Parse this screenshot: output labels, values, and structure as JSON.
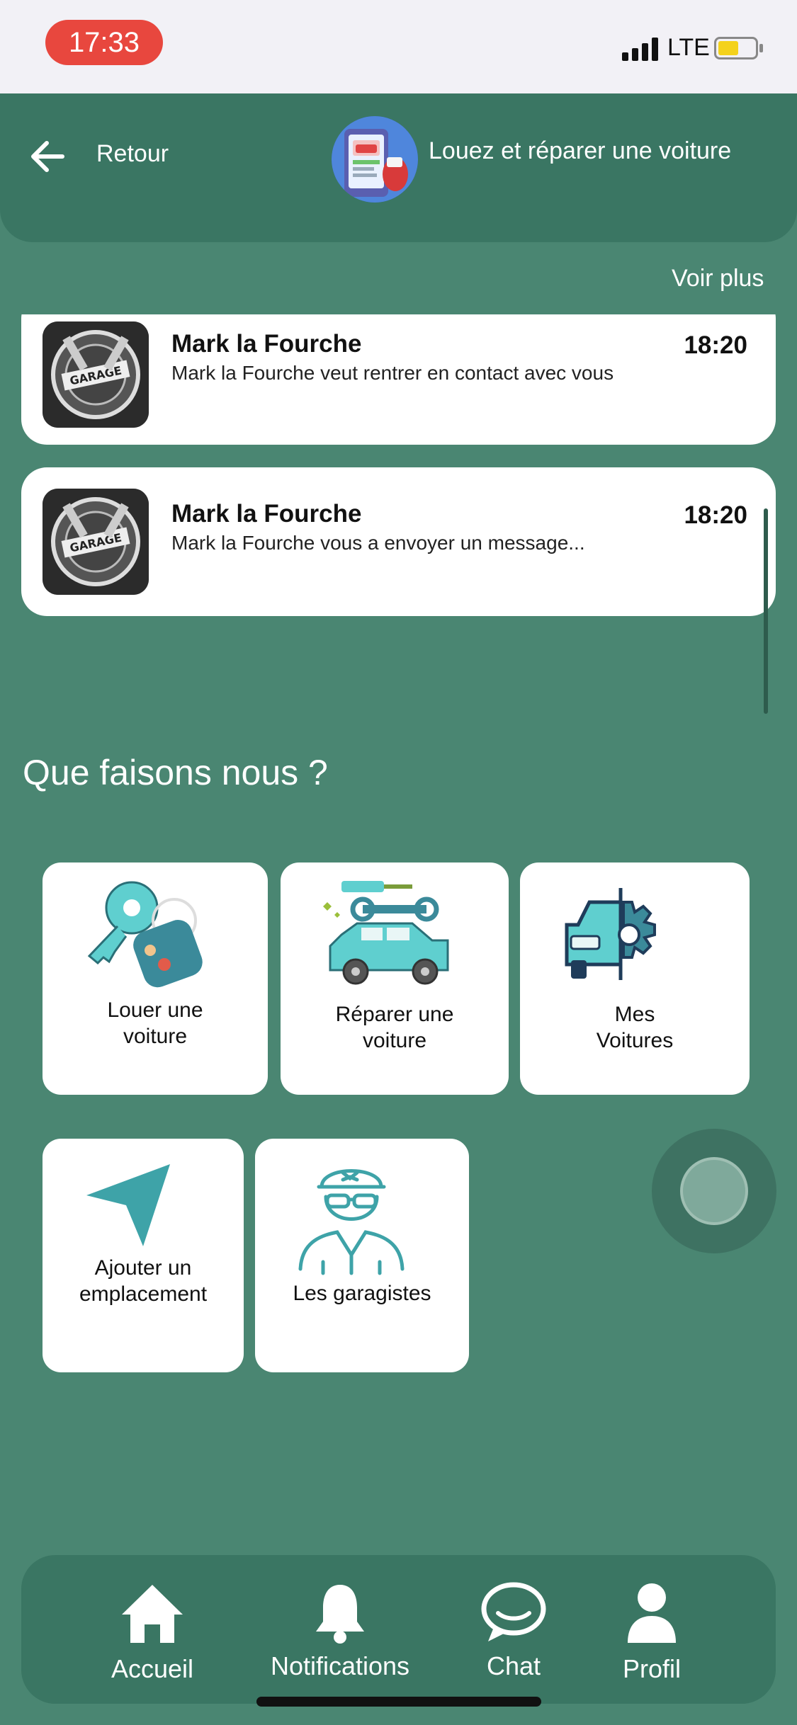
{
  "status_bar": {
    "time": "17:33",
    "network": "LTE"
  },
  "header": {
    "back_label": "Retour",
    "title": "Louez et réparer une voiture"
  },
  "notifications": {
    "see_more": "Voir plus",
    "items": [
      {
        "name": "Mark la Fourche",
        "message": "Mark la Fourche veut rentrer en contact avec vous",
        "time": "18:20"
      },
      {
        "name": "Mark la Fourche",
        "message": "Mark la Fourche vous a envoyer un message...",
        "time": "18:20"
      }
    ]
  },
  "services": {
    "title": "Que faisons nous ?",
    "items": [
      {
        "label": "Louer une voiture",
        "icon": "car-key-icon"
      },
      {
        "label": "Réparer une voiture",
        "icon": "car-repair-icon"
      },
      {
        "label": "Mes Voitures",
        "icon": "car-gear-icon"
      },
      {
        "label": "Ajouter un emplacement",
        "icon": "location-arrow-icon"
      },
      {
        "label": "Les garagistes",
        "icon": "mechanic-icon"
      }
    ]
  },
  "bottom_nav": {
    "items": [
      {
        "label": "Accueil",
        "icon": "home-icon"
      },
      {
        "label": "Notifications",
        "icon": "bell-icon"
      },
      {
        "label": "Chat",
        "icon": "chat-icon"
      },
      {
        "label": "Profil",
        "icon": "profile-icon"
      }
    ]
  },
  "colors": {
    "background": "#4a8672",
    "header": "#3a7663",
    "accent_red": "#e8473e"
  }
}
